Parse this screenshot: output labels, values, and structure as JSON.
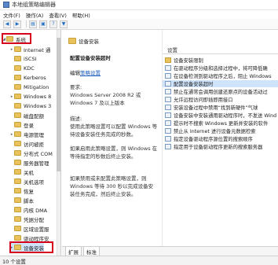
{
  "window": {
    "title": "本地组策略编辑器"
  },
  "menu": [
    "文件(F)",
    "操作(A)",
    "查看(V)",
    "帮助(H)"
  ],
  "tree": {
    "items": [
      {
        "label": "系统",
        "expanded": true,
        "level": 0
      },
      {
        "label": "Internet 通",
        "level": 1
      },
      {
        "label": "iSCSI",
        "level": 1
      },
      {
        "label": "KDC",
        "level": 1
      },
      {
        "label": "Kerberos",
        "level": 1
      },
      {
        "label": "Mitigation",
        "level": 1
      },
      {
        "label": "Windows 8",
        "level": 1
      },
      {
        "label": "Windows 3",
        "level": 1
      },
      {
        "label": "磁盘配额",
        "level": 1
      },
      {
        "label": "登录",
        "level": 1
      },
      {
        "label": "电源管理",
        "level": 1
      },
      {
        "label": "访问被拒",
        "level": 1
      },
      {
        "label": "分布式 COM",
        "level": 1
      },
      {
        "label": "服务器管理",
        "level": 1
      },
      {
        "label": "关机",
        "level": 1
      },
      {
        "label": "关机选项",
        "level": 1
      },
      {
        "label": "恢复",
        "level": 1
      },
      {
        "label": "脚本",
        "level": 1
      },
      {
        "label": "内核 DMA",
        "level": 1
      },
      {
        "label": "凭据分配",
        "level": 1
      },
      {
        "label": "区域设置服",
        "level": 1
      },
      {
        "label": "驱动程序安",
        "level": 1
      },
      {
        "label": "设备安装",
        "level": 1
      }
    ]
  },
  "description": {
    "header": "设备安装",
    "title": "配置设备安装超时",
    "edit_prefix": "编辑",
    "edit_link": "策略设置",
    "requirements_label": "要求:",
    "requirements": "Windows Server 2008 R2 或 Windows 7 及以上版本",
    "description_label": "描述:",
    "description": "使用此策略设置可以配置 Windows 等待设备安装任务完成的秒数。",
    "enabled_text": "如果启用此策略设置，则 Windows 在等待指定的秒数后终止安装。",
    "disabled_text": "如果禁用或未配置此策略设置，则 Windows 等待 300 秒以完成设备安装任务完成，然后终止安装。"
  },
  "settings": {
    "column_header": "设置",
    "rows": [
      {
        "label": "设备安装限制",
        "type": "folder"
      },
      {
        "label": "在驱动程序分级和选择过程中，将可降低确",
        "type": "setting"
      },
      {
        "label": "在设备检测到驱动程序之后，阻止 Windows",
        "type": "setting"
      },
      {
        "label": "配置设备安装超时",
        "type": "setting",
        "selected": true
      },
      {
        "label": "禁止在通常会调用创建还原点的设备活动过",
        "type": "setting"
      },
      {
        "label": "允许远程访问即插即用接口",
        "type": "setting"
      },
      {
        "label": "安装设备过程中禁用“找到新硬件”气球",
        "type": "setting"
      },
      {
        "label": "设备安装中安装通用驱动程序时，不发送 Wind",
        "type": "setting"
      },
      {
        "label": "提示时不搜索 Windows 更新并安装的软件",
        "type": "setting"
      },
      {
        "label": "禁止从 Internet 进行设备元数据检索",
        "type": "setting"
      },
      {
        "label": "指定设备驱动程序源位置的搜索顺序",
        "type": "setting"
      },
      {
        "label": "指定用于设备驱动程序更新的搜索服务器",
        "type": "setting"
      }
    ]
  },
  "tabs": [
    "扩展",
    "标准"
  ],
  "status": {
    "text": "10 个设置"
  },
  "colors": {
    "selection": "#cfe4fb",
    "highlight": "#d6001c",
    "link": "#1f5fbf",
    "folder": "#e8c25a"
  },
  "toolbar_icons": [
    "back-icon",
    "forward-icon",
    "show-hide-tree-icon",
    "properties-icon",
    "help-icon",
    "filter-icon"
  ]
}
